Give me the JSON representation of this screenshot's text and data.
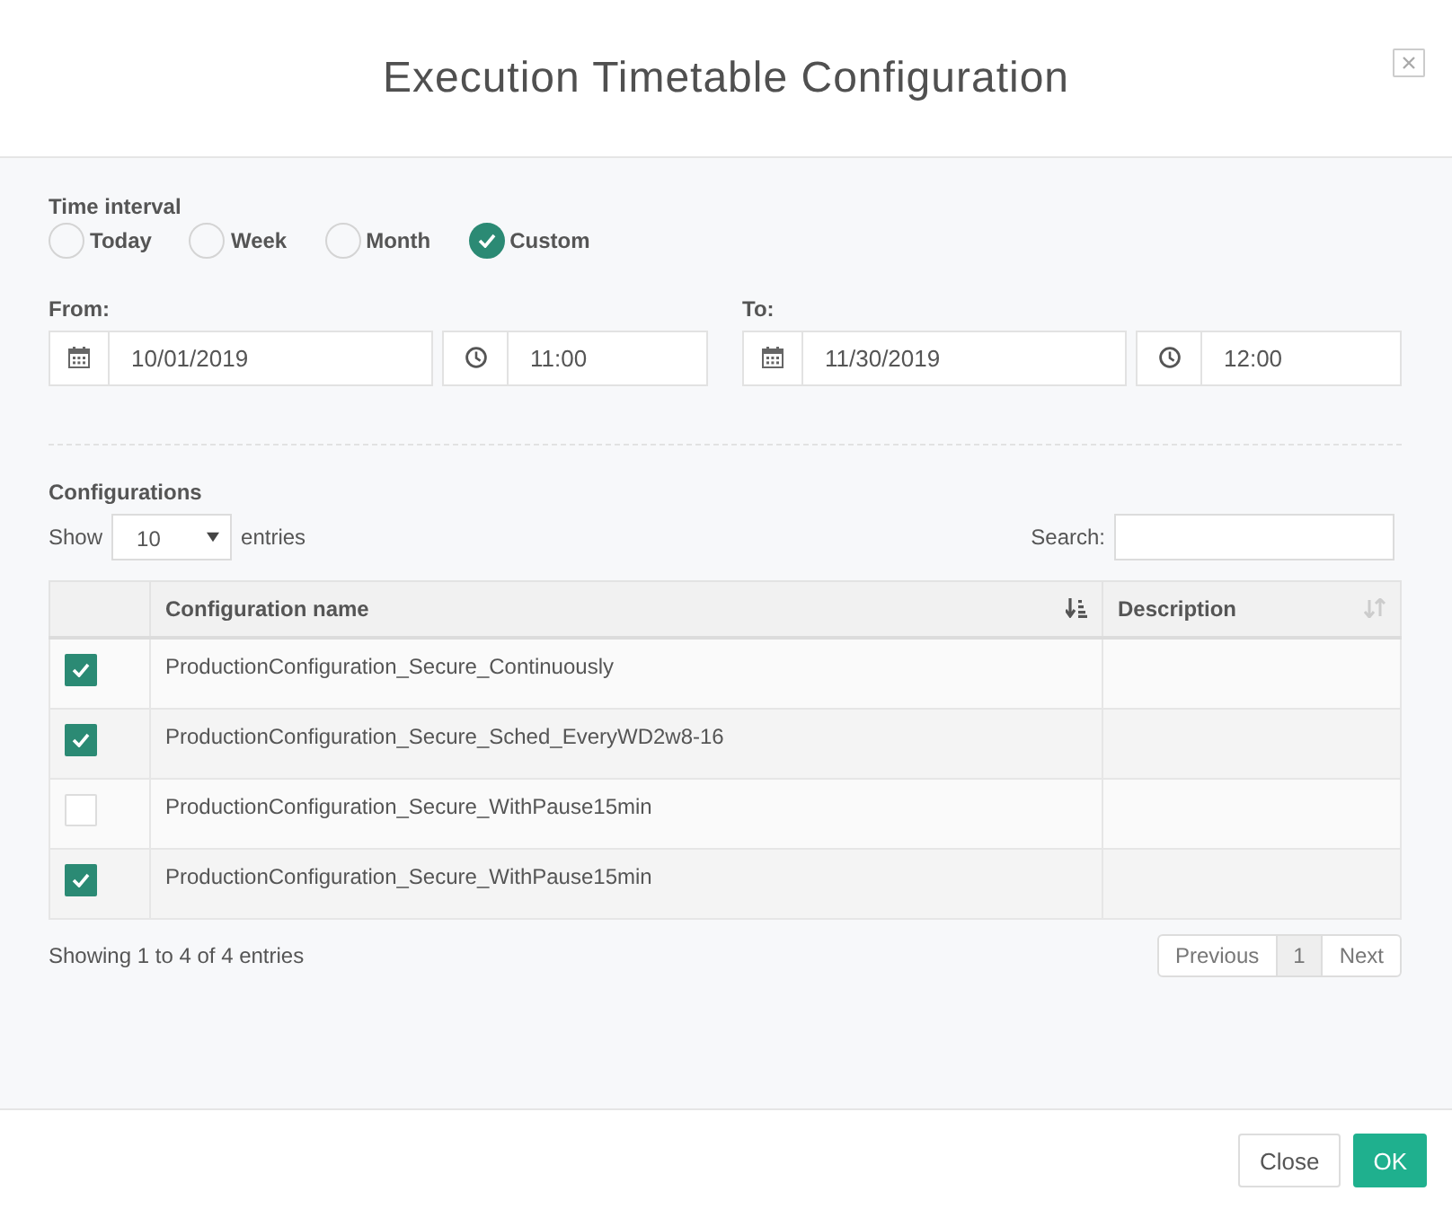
{
  "dialog": {
    "title": "Execution Timetable Configuration"
  },
  "time_interval": {
    "label": "Time interval",
    "options": [
      {
        "label": "Today",
        "selected": false
      },
      {
        "label": "Week",
        "selected": false
      },
      {
        "label": "Month",
        "selected": false
      },
      {
        "label": "Custom",
        "selected": true
      }
    ]
  },
  "range": [
    {
      "label": "From:",
      "date": "10/01/2019",
      "time": "11:00"
    },
    {
      "label": "To:",
      "date": "11/30/2019",
      "time": "12:00"
    }
  ],
  "configurations": {
    "label": "Configurations",
    "show_label": "Show",
    "page_size": "10",
    "entries_label": "entries",
    "search_label": "Search:",
    "columns": [
      {
        "label": "Configuration name",
        "sorted": true
      },
      {
        "label": "Description",
        "sorted": false
      }
    ],
    "rows": [
      {
        "checked": true,
        "name": "ProductionConfiguration_Secure_Continuously"
      },
      {
        "checked": true,
        "name": "ProductionConfiguration_Secure_Sched_EveryWD2w8-16"
      },
      {
        "checked": false,
        "name": "ProductionConfiguration_Secure_WithPause15min"
      },
      {
        "checked": true,
        "name": "ProductionConfiguration_Secure_WithPause15min"
      }
    ],
    "info": "Showing 1 to 4 of 4 entries",
    "pagination": [
      {
        "label": "Previous",
        "selected": false
      },
      {
        "label": "1",
        "selected": true
      },
      {
        "label": "Next",
        "selected": false
      }
    ]
  },
  "footer": {
    "buttons": [
      {
        "label": "Close",
        "kind": "default"
      },
      {
        "label": "OK",
        "kind": "primary"
      }
    ]
  }
}
